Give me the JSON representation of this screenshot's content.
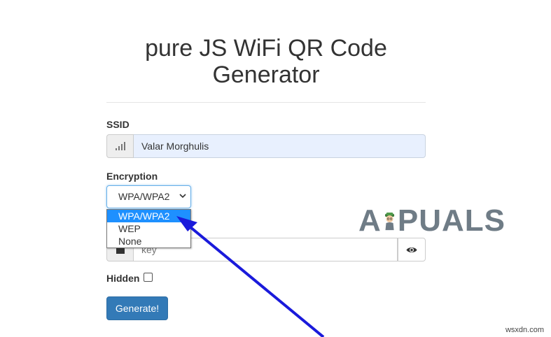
{
  "page": {
    "title": "pure JS WiFi QR Code Generator"
  },
  "ssid": {
    "label": "SSID",
    "value": "Valar Morghulis",
    "icon": "signal-icon"
  },
  "encryption": {
    "label": "Encryption",
    "selected": "WPA/WPA2",
    "options": [
      "WPA/WPA2",
      "WEP",
      "None"
    ],
    "highlighted_option": "WPA/WPA2"
  },
  "key": {
    "placeholder": "key",
    "icon": "lock-icon",
    "toggle_icon": "eye-icon"
  },
  "hidden": {
    "label": "Hidden",
    "checked": false
  },
  "generate_button": {
    "label": "Generate!"
  },
  "overlay": {
    "logo_text_left": "A",
    "logo_text_right": "PUALS",
    "watermark": "wsxdn.com",
    "arrow_color": "#1a1adb"
  },
  "colors": {
    "primary": "#337ab7",
    "highlight": "#1e90ff",
    "ssid_bg": "#e8f0fe"
  }
}
